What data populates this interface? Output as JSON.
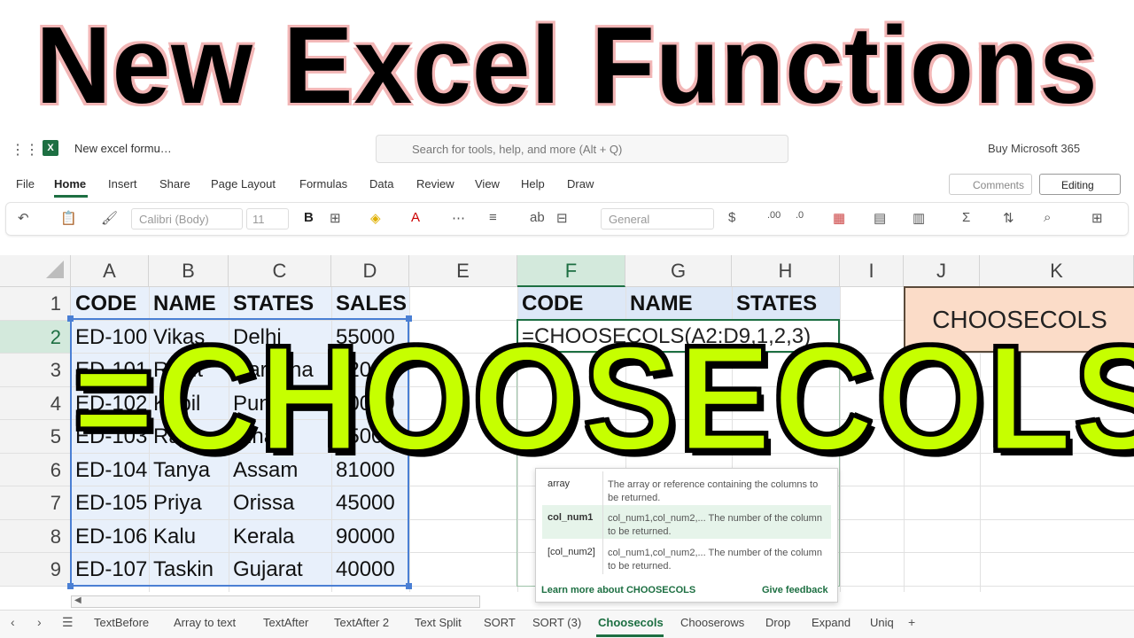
{
  "banner": {
    "title": "New Excel Functions",
    "overlay": "=CHOOSECOLS"
  },
  "window": {
    "doc_name": "New excel formu…",
    "search_placeholder": "Search for tools, help, and more (Alt + Q)",
    "buy_text": "Buy Microsoft 365"
  },
  "ribbon": {
    "tabs": [
      "File",
      "Home",
      "Insert",
      "Share",
      "Page Layout",
      "Formulas",
      "Data",
      "Review",
      "View",
      "Help",
      "Draw"
    ],
    "active_tab": "Home",
    "comments_label": "Comments",
    "editing_label": "Editing",
    "font_name": "Calibri (Body)",
    "font_size": "11",
    "number_format": "General"
  },
  "grid": {
    "columns": [
      "A",
      "B",
      "C",
      "D",
      "E",
      "F",
      "G",
      "H",
      "I",
      "J",
      "K"
    ],
    "selected_column": "F",
    "rows": [
      "1",
      "2",
      "3",
      "4",
      "5",
      "6",
      "7",
      "8",
      "9"
    ],
    "selected_row": "2",
    "table_headers": [
      "CODE",
      "NAME",
      "STATES",
      "SALES"
    ],
    "table_rows": [
      [
        "ED-100",
        "Vikas",
        "Delhi",
        "55000"
      ],
      [
        "ED-101",
        "Rohit",
        "Haryana",
        "62000"
      ],
      [
        "ED-102",
        "Kapil",
        "Punjab",
        "70000"
      ],
      [
        "ED-103",
        "Raj",
        "Bihar",
        "35000"
      ],
      [
        "ED-104",
        "Tanya",
        "Assam",
        "81000"
      ],
      [
        "ED-105",
        "Priya",
        "Orissa",
        "45000"
      ],
      [
        "ED-106",
        "Kalu",
        "Kerala",
        "90000"
      ],
      [
        "ED-107",
        "Taskin",
        "Gujarat",
        "40000"
      ]
    ],
    "result_headers": [
      "CODE",
      "NAME",
      "STATES"
    ],
    "active_cell_formula": "=CHOOSECOLS(A2:D9,1,2,3)",
    "label_box": "CHOOSECOLS"
  },
  "tooltip": {
    "params": [
      {
        "name": "array",
        "desc": "The array or reference containing the columns to be returned."
      },
      {
        "name": "col_num1",
        "desc": "col_num1,col_num2,... The number of the column to be returned."
      },
      {
        "name": "[col_num2]",
        "desc": "col_num1,col_num2,... The number of the column to be returned."
      }
    ],
    "learn_more": "Learn more about CHOOSECOLS",
    "feedback": "Give feedback"
  },
  "sheet_tabs": [
    "TextBefore",
    "Array to text",
    "TextAfter",
    "TextAfter 2",
    "Text Split",
    "SORT",
    "SORT (3)",
    "Choosecols",
    "Chooserows",
    "Drop",
    "Expand",
    "Uniq"
  ],
  "active_sheet": "Choosecols",
  "colors": {
    "excel_green": "#1d6f42",
    "overlay_lime": "#c6ff00",
    "selection_blue": "#4a7fd4"
  }
}
